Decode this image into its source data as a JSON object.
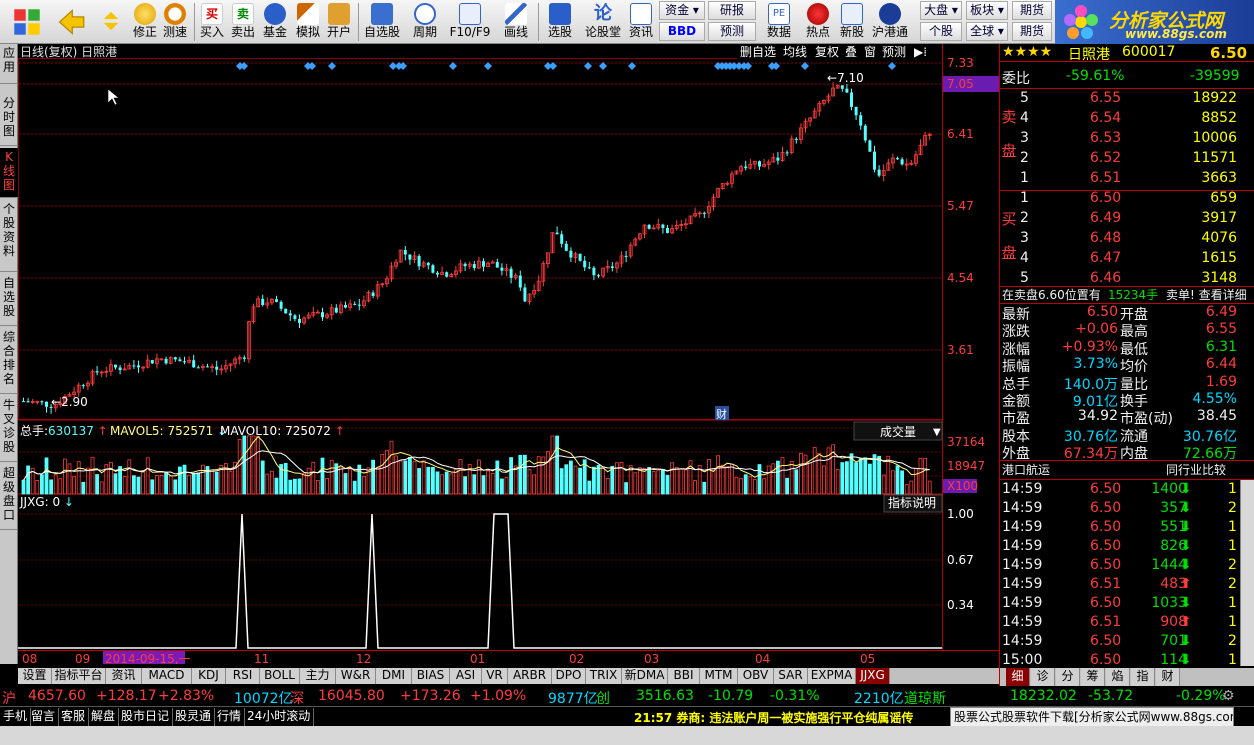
{
  "toolbar": {
    "buttons": [
      "",
      "",
      "修正",
      "测速",
      "买入",
      "卖出",
      "基金",
      "模拟",
      "开户",
      "自选股",
      "周期",
      "F10/F9",
      "画线",
      "选股",
      "论股堂",
      "资讯",
      "数据",
      "热点",
      "新股",
      "沪港通"
    ],
    "small_buttons": [
      "资金",
      "研报",
      "BBD",
      "预测",
      "大盘",
      "板块",
      "期货",
      "个股",
      "全球",
      "期货"
    ]
  },
  "logo": {
    "title": "分析家公式网",
    "url": "www.88gs.com"
  },
  "left_tabs": [
    "应用",
    "分时图",
    "K线图",
    "个股资料",
    "自选股",
    "综合排名",
    "牛叉诊股",
    "超级盘口"
  ],
  "chart": {
    "title": "日线(复权) 日照港",
    "header_buttons": [
      "删自选",
      "均线",
      "复权",
      "叠",
      "窗",
      "预测"
    ],
    "price_ticks": [
      "7.33",
      "7.05",
      "6.41",
      "5.47",
      "4.54",
      "3.61"
    ],
    "high_label": "7.10",
    "low_label": "2.90",
    "caifu_label": "财",
    "volume_header": {
      "name": "总手:",
      "value": "630137",
      "ma5_label": "MAVOL5:",
      "ma5_value": "752571",
      "ma10_label": "MAVOL10:",
      "ma10_value": "725072"
    },
    "volume_dropdown": "成交量",
    "volume_ticks": [
      "37164",
      "18947",
      "X100"
    ],
    "indicator_header": {
      "name": "JJXG:",
      "value": "0"
    },
    "indicator_button": "指标说明",
    "indicator_ticks": [
      "1.00",
      "0.67",
      "0.34"
    ],
    "months": [
      "08",
      "09",
      "2014-09-15,一",
      "11",
      "12",
      "01",
      "02",
      "03",
      "04",
      "05"
    ]
  },
  "bottom_tabs": [
    "设置",
    "指标平台",
    "资讯",
    "MACD",
    "KDJ",
    "RSI",
    "BOLL",
    "主力",
    "W&R",
    "DMI",
    "BIAS",
    "ASI",
    "VR",
    "ARBR",
    "DPO",
    "TRIX",
    "新DMA",
    "BBI",
    "MTM",
    "OBV",
    "SAR",
    "EXPMA",
    "JJXG"
  ],
  "right": {
    "stock_name": "日照港",
    "stock_code": "600017",
    "weibi": {
      "label": "委比",
      "pct": "-59.61%",
      "diff": "-39599"
    },
    "sell": [
      {
        "n": "5",
        "price": "6.55",
        "vol": "18922"
      },
      {
        "n": "4",
        "price": "6.54",
        "vol": "8852"
      },
      {
        "n": "3",
        "price": "6.53",
        "vol": "10006"
      },
      {
        "n": "2",
        "price": "6.52",
        "vol": "11571"
      },
      {
        "n": "1",
        "price": "6.51",
        "vol": "3663"
      }
    ],
    "sell_label": "卖 盘",
    "buy": [
      {
        "n": "1",
        "price": "6.50",
        "vol": "659"
      },
      {
        "n": "2",
        "price": "6.49",
        "vol": "3917"
      },
      {
        "n": "3",
        "price": "6.48",
        "vol": "4076"
      },
      {
        "n": "4",
        "price": "6.47",
        "vol": "1615"
      },
      {
        "n": "5",
        "price": "6.46",
        "vol": "3148"
      }
    ],
    "buy_label": "买 盘",
    "notice": {
      "pre": "在卖盘6.60位置有",
      "vol": "15234手",
      "post": "卖单! 查看详细"
    },
    "stats": [
      {
        "k1": "最新",
        "v1": "6.50",
        "k2": "开盘",
        "v2": "6.49"
      },
      {
        "k1": "涨跌",
        "v1": "+0.06",
        "k2": "最高",
        "v2": "6.55"
      },
      {
        "k1": "涨幅",
        "v1": "+0.93%",
        "k2": "最低",
        "v2": "6.31"
      },
      {
        "k1": "振幅",
        "v1": "3.73%",
        "k2": "均价",
        "v2": "6.44"
      },
      {
        "k1": "总手",
        "v1": "140.0万",
        "k2": "量比",
        "v2": "1.69"
      },
      {
        "k1": "金额",
        "v1": "9.01亿",
        "k2": "换手",
        "v2": "4.55%"
      },
      {
        "k1": "市盈",
        "v1": "34.92",
        "k2": "市盈(动)",
        "v2": "38.45"
      },
      {
        "k1": "股本",
        "v1": "30.76亿",
        "k2": "流通",
        "v2": "30.76亿"
      },
      {
        "k1": "外盘",
        "v1": "67.34万",
        "k2": "内盘",
        "v2": "72.66万"
      }
    ],
    "industry": {
      "name": "港口航运",
      "compare": "同行业比较"
    },
    "ticks": [
      {
        "t": "14:59",
        "p": "6.50",
        "v": "1400",
        "d": "down",
        "n": "1"
      },
      {
        "t": "14:59",
        "p": "6.50",
        "v": "357",
        "d": "down",
        "n": "2"
      },
      {
        "t": "14:59",
        "p": "6.50",
        "v": "551",
        "d": "down",
        "n": "1"
      },
      {
        "t": "14:59",
        "p": "6.50",
        "v": "826",
        "d": "down",
        "n": "1"
      },
      {
        "t": "14:59",
        "p": "6.50",
        "v": "1444",
        "d": "down",
        "n": "2"
      },
      {
        "t": "14:59",
        "p": "6.51",
        "v": "483",
        "d": "up",
        "n": "2"
      },
      {
        "t": "14:59",
        "p": "6.50",
        "v": "1033",
        "d": "down",
        "n": "1"
      },
      {
        "t": "14:59",
        "p": "6.51",
        "v": "908",
        "d": "up",
        "n": "1"
      },
      {
        "t": "14:59",
        "p": "6.50",
        "v": "701",
        "d": "down",
        "n": "2"
      },
      {
        "t": "15:00",
        "p": "6.50",
        "v": "114",
        "d": "down",
        "n": "1"
      }
    ],
    "tabs": [
      "细",
      "诊",
      "分",
      "筹",
      "焰",
      "指",
      "财"
    ]
  },
  "index_bar": {
    "sh": {
      "name": "沪",
      "val": "4657.60",
      "chg": "+128.17",
      "pct": "+2.83%",
      "amt": "10072亿"
    },
    "sz": {
      "name": "深",
      "val": "16045.80",
      "chg": "+173.26",
      "pct": "+1.09%",
      "amt": "9877亿"
    },
    "cy": {
      "name": "创",
      "val": "3516.63",
      "chg": "-10.79",
      "pct": "-0.31%",
      "amt": "2210亿"
    },
    "dj": {
      "name": "道琼斯",
      "val": "18232.02",
      "chg": "-53.72",
      "pct": "-0.29%"
    }
  },
  "status_bar": {
    "tabs": [
      "手机",
      "留言",
      "客服",
      "解盘",
      "股市日记",
      "股灵通",
      "行情",
      "24小时滚动"
    ],
    "news": "21:57 券商: 违法账户周一被实施强行平仓纯属谣传",
    "ad": "股票公式股票软件下载[分析家公式网www.88gs.com]"
  },
  "colors": {
    "up": "#ff3c3c",
    "down": "#00e000",
    "cyan": "#54ffff",
    "grid": "#8b0000",
    "ma": "#ffff80"
  }
}
